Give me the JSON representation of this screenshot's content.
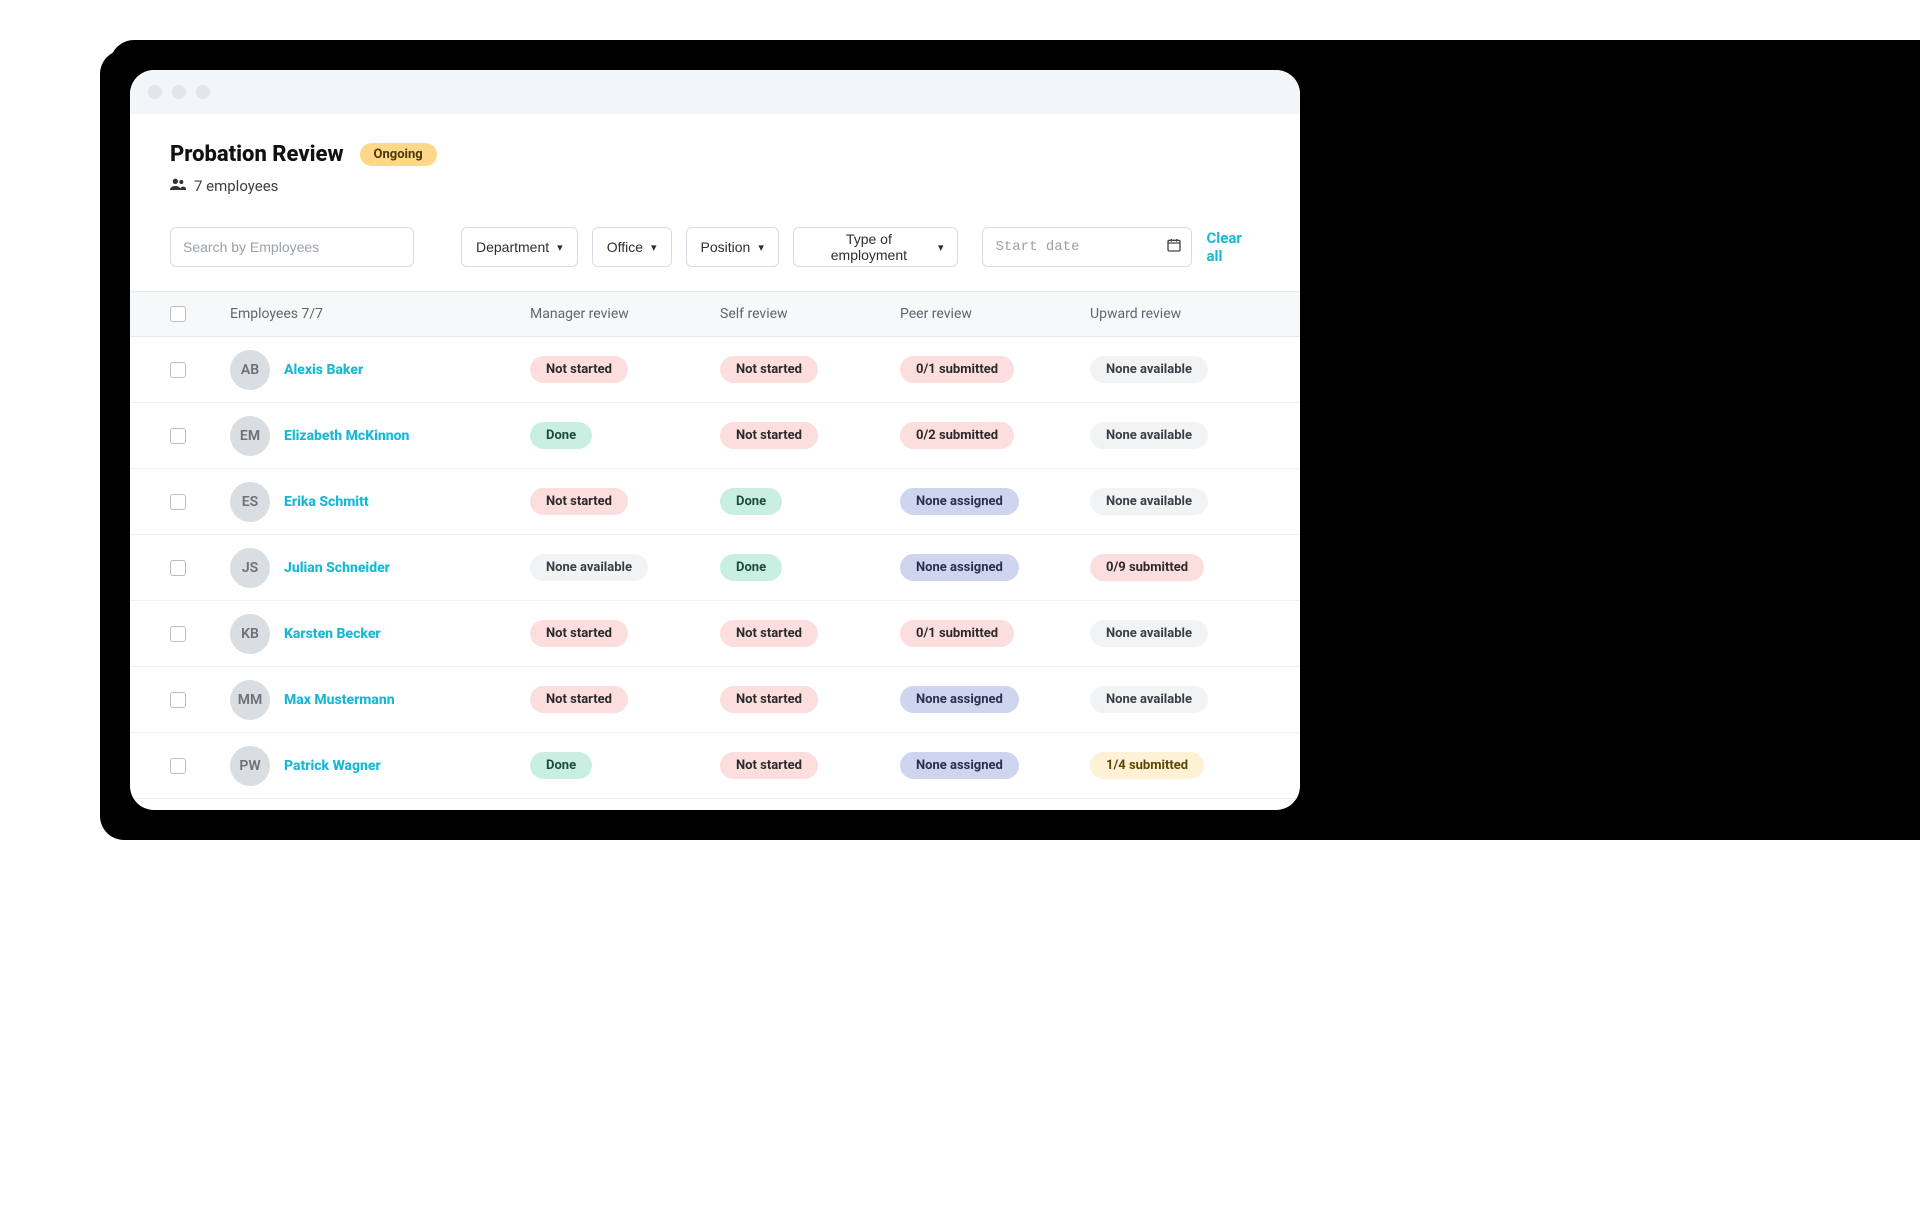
{
  "header": {
    "title": "Probation Review",
    "status": "Ongoing",
    "employee_count_label": "7 employees",
    "people_icon": "people-icon"
  },
  "filters": {
    "search_placeholder": "Search by Employees",
    "department": "Department",
    "office": "Office",
    "position": "Position",
    "employment_type": "Type of employment",
    "date_placeholder": "Start date",
    "clear_all": "Clear all"
  },
  "table": {
    "columns": {
      "employees": "Employees 7/7",
      "manager": "Manager review",
      "self": "Self review",
      "peer": "Peer review",
      "upward": "Upward review"
    },
    "rows": [
      {
        "name": "Alexis Baker",
        "initials": "AB",
        "manager": {
          "text": "Not started",
          "tone": "red"
        },
        "self": {
          "text": "Not started",
          "tone": "red"
        },
        "peer": {
          "text": "0/1 submitted",
          "tone": "red"
        },
        "upward": {
          "text": "None available",
          "tone": "grey"
        }
      },
      {
        "name": "Elizabeth McKinnon",
        "initials": "EM",
        "manager": {
          "text": "Done",
          "tone": "green"
        },
        "self": {
          "text": "Not started",
          "tone": "red"
        },
        "peer": {
          "text": "0/2 submitted",
          "tone": "red"
        },
        "upward": {
          "text": "None available",
          "tone": "grey"
        }
      },
      {
        "name": "Erika Schmitt",
        "initials": "ES",
        "manager": {
          "text": "Not started",
          "tone": "red"
        },
        "self": {
          "text": "Done",
          "tone": "green"
        },
        "peer": {
          "text": "None assigned",
          "tone": "blue"
        },
        "upward": {
          "text": "None available",
          "tone": "grey"
        }
      },
      {
        "name": "Julian Schneider",
        "initials": "JS",
        "manager": {
          "text": "None available",
          "tone": "grey"
        },
        "self": {
          "text": "Done",
          "tone": "green"
        },
        "peer": {
          "text": "None assigned",
          "tone": "blue"
        },
        "upward": {
          "text": "0/9 submitted",
          "tone": "red"
        }
      },
      {
        "name": "Karsten Becker",
        "initials": "KB",
        "manager": {
          "text": "Not started",
          "tone": "red"
        },
        "self": {
          "text": "Not started",
          "tone": "red"
        },
        "peer": {
          "text": "0/1 submitted",
          "tone": "red"
        },
        "upward": {
          "text": "None available",
          "tone": "grey"
        }
      },
      {
        "name": "Max Mustermann",
        "initials": "MM",
        "manager": {
          "text": "Not started",
          "tone": "red"
        },
        "self": {
          "text": "Not started",
          "tone": "red"
        },
        "peer": {
          "text": "None assigned",
          "tone": "blue"
        },
        "upward": {
          "text": "None available",
          "tone": "grey"
        }
      },
      {
        "name": "Patrick Wagner",
        "initials": "PW",
        "manager": {
          "text": "Done",
          "tone": "green"
        },
        "self": {
          "text": "Not started",
          "tone": "red"
        },
        "peer": {
          "text": "None assigned",
          "tone": "blue"
        },
        "upward": {
          "text": "1/4 submitted",
          "tone": "yellow"
        }
      }
    ]
  }
}
